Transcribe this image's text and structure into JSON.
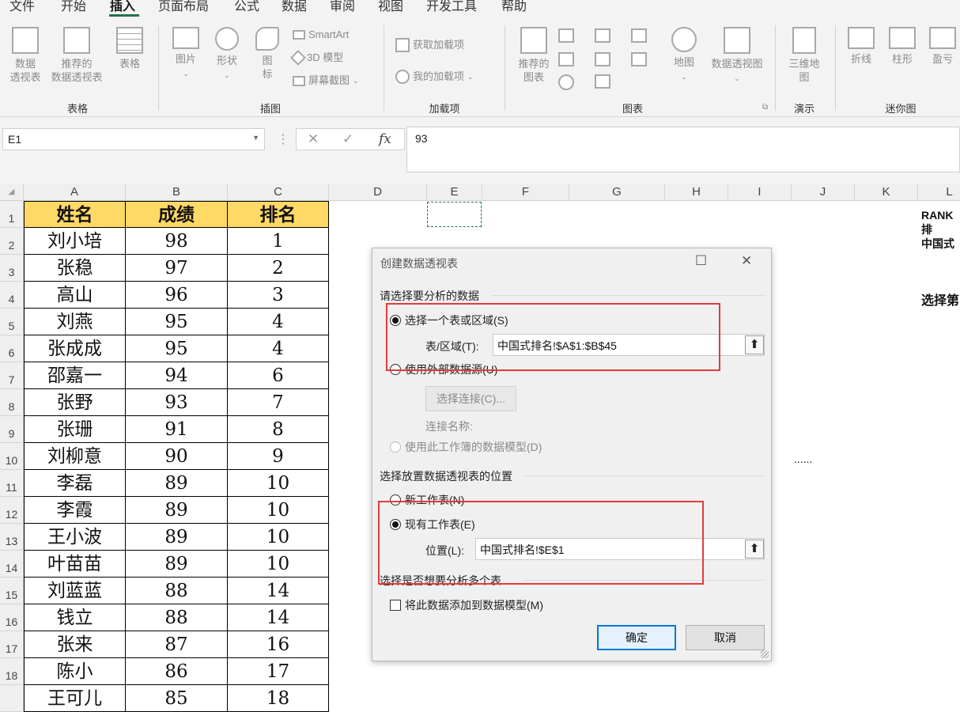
{
  "menu": {
    "items": [
      "文件",
      "开始",
      "插入",
      "页面布局",
      "公式",
      "数据",
      "审阅",
      "视图",
      "开发工具",
      "帮助"
    ],
    "active": "插入"
  },
  "ribbon": {
    "pivot_table": "数据\n透视表",
    "recommended_pivot": "推荐的\n数据透视表",
    "table": "表格",
    "pictures": "图片",
    "shapes": "形状",
    "icons": "图\n标",
    "smartart": "SmartArt",
    "model3d": "3D 模型",
    "screenshot": "屏幕截图",
    "get_addins": "获取加载项",
    "my_addins": "我的加载项",
    "recommended_charts": "推荐的\n图表",
    "maps": "地图",
    "pivot_chart": "数据透视图",
    "map3d": "三维地\n图",
    "sparkline_line": "折线",
    "sparkline_column": "柱形",
    "sparkline_winloss": "盈亏",
    "groups": {
      "tables": "表格",
      "illustrations": "插图",
      "addins": "加载项",
      "charts": "图表",
      "tours": "演示",
      "sparklines": "迷你图"
    }
  },
  "formula_bar": {
    "name_box": "E1",
    "cancel": "✕",
    "enter": "✓",
    "fx": "fx",
    "formula": "93"
  },
  "columns": [
    "A",
    "B",
    "C",
    "D",
    "E",
    "F",
    "G",
    "H",
    "I",
    "J",
    "K",
    "L"
  ],
  "table": {
    "headers": [
      "姓名",
      "成绩",
      "排名"
    ],
    "rows": [
      [
        "刘小培",
        "98",
        "1"
      ],
      [
        "张稳",
        "97",
        "2"
      ],
      [
        "高山",
        "96",
        "3"
      ],
      [
        "刘燕",
        "95",
        "4"
      ],
      [
        "张成成",
        "95",
        "4"
      ],
      [
        "邵嘉一",
        "94",
        "6"
      ],
      [
        "张野",
        "93",
        "7"
      ],
      [
        "张珊",
        "91",
        "8"
      ],
      [
        "刘柳意",
        "90",
        "9"
      ],
      [
        "李磊",
        "89",
        "10"
      ],
      [
        "李霞",
        "89",
        "10"
      ],
      [
        "王小波",
        "89",
        "10"
      ],
      [
        "叶苗苗",
        "89",
        "10"
      ],
      [
        "刘蓝蓝",
        "88",
        "14"
      ],
      [
        "钱立",
        "88",
        "14"
      ],
      [
        "张来",
        "87",
        "16"
      ],
      [
        "陈小",
        "86",
        "17"
      ],
      [
        "王可儿",
        "85",
        "18"
      ]
    ],
    "row_numbers": [
      "1",
      "2",
      "3",
      "4",
      "5",
      "6",
      "7",
      "8",
      "9",
      "10",
      "11",
      "12",
      "13",
      "14",
      "15",
      "16",
      "17",
      "18"
    ]
  },
  "notes": {
    "l1": "RANK排",
    "l2": "中国式",
    "l3": "选择第",
    "dots": "......"
  },
  "dialog": {
    "title": "创建数据透视表",
    "section1": "请选择要分析的数据",
    "opt_range": "选择一个表或区域(S)",
    "range_label": "表/区域(T):",
    "range_value": "中国式排名!$A$1:$B$45",
    "opt_external": "使用外部数据源(U)",
    "choose_conn": "选择连接(C)...",
    "conn_name": "连接名称:",
    "opt_model": "使用此工作簿的数据模型(D)",
    "section2": "选择放置数据透视表的位置",
    "opt_new": "新工作表(N)",
    "opt_existing": "现有工作表(E)",
    "location_label": "位置(L):",
    "location_value": "中国式排名!$E$1",
    "section3": "选择是否想要分析多个表",
    "add_model": "将此数据添加到数据模型(M)",
    "ok": "确定",
    "cancel": "取消"
  }
}
